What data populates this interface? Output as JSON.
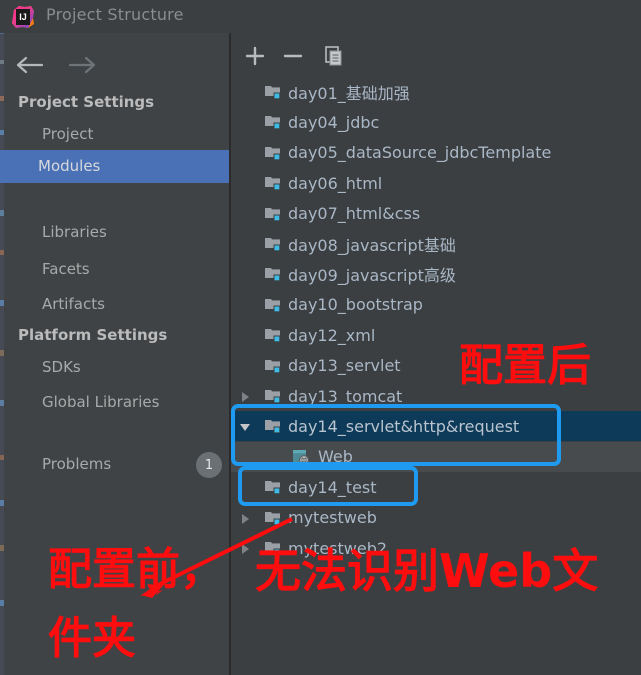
{
  "window": {
    "title": "Project Structure",
    "logo_icon": "intellij-idea-logo"
  },
  "nav": {
    "back_icon": "arrow-left-icon",
    "forward_icon": "arrow-right-icon"
  },
  "sidebar": {
    "sections": [
      {
        "header": "Project Settings",
        "items": [
          {
            "label": "Project",
            "selected": false
          },
          {
            "label": "Modules",
            "selected": true
          },
          {
            "label": "Libraries",
            "selected": false
          },
          {
            "label": "Facets",
            "selected": false
          },
          {
            "label": "Artifacts",
            "selected": false
          }
        ]
      },
      {
        "header": "Platform Settings",
        "items": [
          {
            "label": "SDKs",
            "selected": false
          },
          {
            "label": "Global Libraries",
            "selected": false
          }
        ]
      }
    ],
    "problems": {
      "label": "Problems",
      "count": "1"
    },
    "selection_color": "#4a70b5"
  },
  "toolbar": {
    "add_label": "+",
    "add_icon": "plus-icon",
    "remove_label": "−",
    "remove_icon": "minus-icon",
    "copy_icon": "copy-module-icon"
  },
  "tree": {
    "nodes": [
      {
        "label": "day01_基础加强",
        "icon": "module-folder-icon",
        "twisty": "",
        "depth": 0,
        "state": "normal"
      },
      {
        "label": "day04_jdbc",
        "icon": "module-folder-icon",
        "twisty": "",
        "depth": 0,
        "state": "normal"
      },
      {
        "label": "day05_dataSource_jdbcTemplate",
        "icon": "module-folder-icon",
        "twisty": "",
        "depth": 0,
        "state": "normal"
      },
      {
        "label": "day06_html",
        "icon": "module-folder-icon",
        "twisty": "",
        "depth": 0,
        "state": "normal"
      },
      {
        "label": "day07_html&css",
        "icon": "module-folder-icon",
        "twisty": "",
        "depth": 0,
        "state": "normal"
      },
      {
        "label": "day08_javascript基础",
        "icon": "module-folder-icon",
        "twisty": "",
        "depth": 0,
        "state": "normal"
      },
      {
        "label": "day09_javascript高级",
        "icon": "module-folder-icon",
        "twisty": "",
        "depth": 0,
        "state": "normal"
      },
      {
        "label": "day10_bootstrap",
        "icon": "module-folder-icon",
        "twisty": "",
        "depth": 0,
        "state": "normal"
      },
      {
        "label": "day12_xml",
        "icon": "module-folder-icon",
        "twisty": "",
        "depth": 0,
        "state": "normal"
      },
      {
        "label": "day13_servlet",
        "icon": "module-folder-icon",
        "twisty": "",
        "depth": 0,
        "state": "normal"
      },
      {
        "label": "day13_tomcat",
        "icon": "module-folder-icon",
        "twisty": "collapsed",
        "depth": 0,
        "state": "normal"
      },
      {
        "label": "day14_servlet&http&request",
        "icon": "module-folder-icon",
        "twisty": "expanded",
        "depth": 0,
        "state": "selected"
      },
      {
        "label": "Web",
        "icon": "web-facet-icon",
        "twisty": "",
        "depth": 1,
        "state": "subselected"
      },
      {
        "label": "day14_test",
        "icon": "module-folder-icon",
        "twisty": "",
        "depth": 0,
        "state": "normal"
      },
      {
        "label": "mytestweb",
        "icon": "module-folder-icon",
        "twisty": "collapsed",
        "depth": 0,
        "state": "normal"
      },
      {
        "label": "mytestweb2",
        "icon": "module-folder-icon",
        "twisty": "collapsed",
        "depth": 0,
        "state": "normal"
      }
    ]
  },
  "annotations": {
    "after_config": "配置后",
    "before_config_line1": "配置前，",
    "before_config_line2": "件夹",
    "cannot_recognize": "无法识别Web文",
    "highlight_color": "#1e9bf0",
    "annotation_color": "#fd0d0d",
    "arrow_icon": "red-arrow-icon"
  }
}
